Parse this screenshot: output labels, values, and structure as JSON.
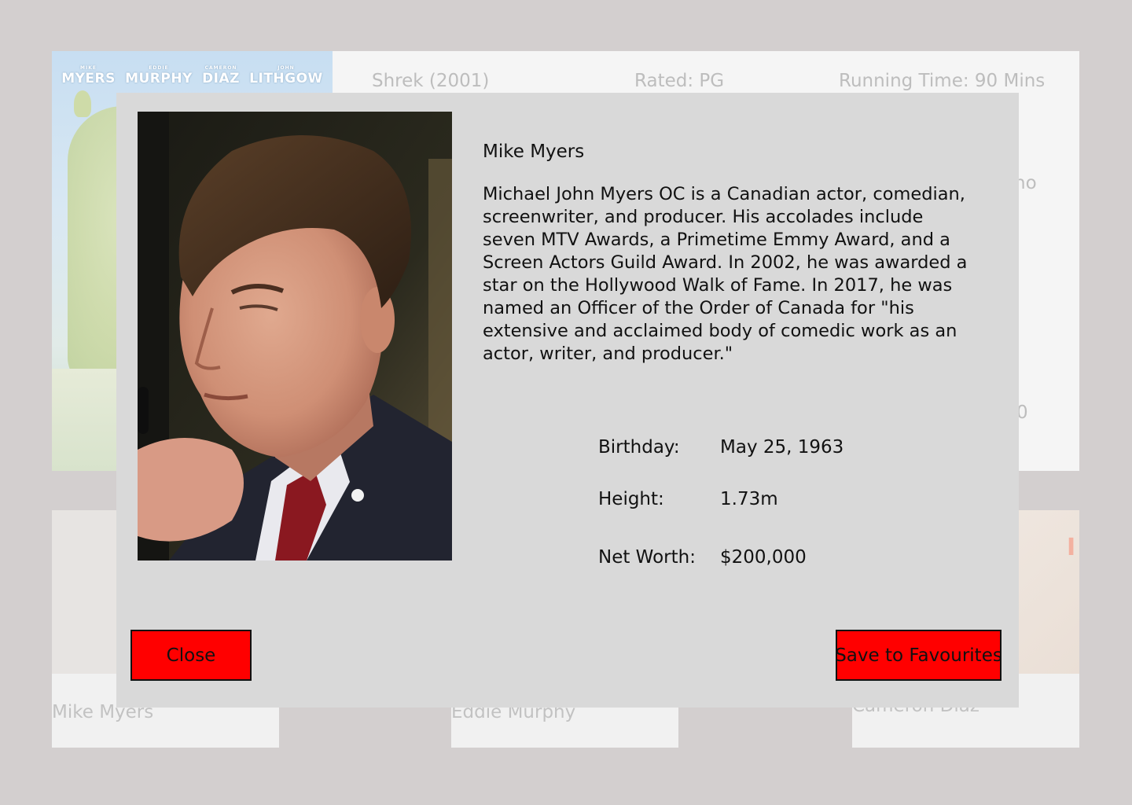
{
  "background": {
    "poster": {
      "cast_names": [
        {
          "first": "MIKE",
          "last": "MYERS"
        },
        {
          "first": "EDDIE",
          "last": "MURPHY"
        },
        {
          "first": "CAMERON",
          "last": "DIAZ"
        },
        {
          "first": "JOHN",
          "last": "LITHGOW"
        }
      ]
    },
    "movie": {
      "title": "Shrek (2001)",
      "rating": "Rated: PG",
      "runtime": "Running Time: 90 Mins",
      "partial_text_1": "no",
      "partial_text_2": "0"
    },
    "cast": [
      {
        "label": "Mike Myers"
      },
      {
        "label": "Eddie Murphy"
      },
      {
        "label": "Cameron Diaz"
      }
    ],
    "cast_card_3_accent": "I"
  },
  "modal": {
    "name": "Mike Myers",
    "bio": "Michael John Myers OC is a Canadian actor, comedian, screenwriter, and producer. His accolades include seven MTV Awards, a Primetime Emmy Award, and a Screen Actors Guild Award. In 2002, he was awarded a star on the Hollywood Walk of Fame. In 2017, he was named an Officer of the Order of Canada for \"his extensive and acclaimed body of comedic work as an actor, writer, and producer.\"",
    "stats": {
      "birthday_label": "Birthday:",
      "birthday_value": "May 25, 1963",
      "height_label": "Height:",
      "height_value": "1.73m",
      "networth_label": "Net Worth:",
      "networth_value": "$200,000"
    },
    "buttons": {
      "close": "Close",
      "save": "Save to Favourites"
    },
    "colors": {
      "button_bg": "#ff0000",
      "modal_bg": "#d9d9d9",
      "page_bg": "#d3cfcf"
    }
  }
}
